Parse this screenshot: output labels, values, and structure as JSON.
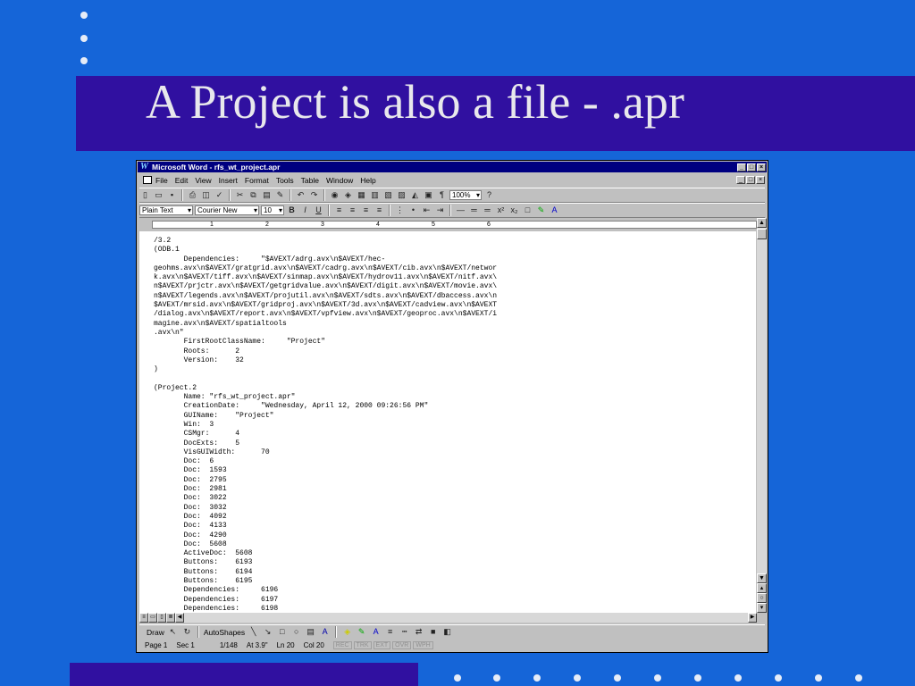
{
  "slide": {
    "title": "A Project is also a file - .apr"
  },
  "window": {
    "title": "Microsoft Word - rfs_wt_project.apr",
    "menu": [
      "File",
      "Edit",
      "View",
      "Insert",
      "Format",
      "Tools",
      "Table",
      "Window",
      "Help"
    ]
  },
  "formatting": {
    "style": "Plain Text",
    "font": "Courier New",
    "size": "10",
    "zoom": "100%",
    "bold": "B",
    "italic": "I",
    "underline": "U"
  },
  "ruler": {
    "numbers": [
      "1",
      "2",
      "3",
      "4",
      "5",
      "6"
    ]
  },
  "document": {
    "text": "/3.2\n(ODB.1\n       Dependencies:     \"$AVEXT/adrg.avx\\n$AVEXT/hec-\ngeohms.avx\\n$AVEXT/gratgrid.avx\\n$AVEXT/cadrg.avx\\n$AVEXT/cib.avx\\n$AVEXT/networ\nk.avx\\n$AVEXT/tiff.avx\\n$AVEXT/sinmap.avx\\n$AVEXT/hydrov11.avx\\n$AVEXT/nitf.avx\\\nn$AVEXT/prjctr.avx\\n$AVEXT/getgridvalue.avx\\n$AVEXT/digit.avx\\n$AVEXT/movie.avx\\\nn$AVEXT/legends.avx\\n$AVEXT/projutil.avx\\n$AVEXT/sdts.avx\\n$AVEXT/dbaccess.avx\\n\n$AVEXT/mrsid.avx\\n$AVEXT/gridproj.avx\\n$AVEXT/3d.avx\\n$AVEXT/cadview.avx\\n$AVEXT\n/dialog.avx\\n$AVEXT/report.avx\\n$AVEXT/vpfview.avx\\n$AVEXT/geoproc.avx\\n$AVEXT/i\nmagine.avx\\n$AVEXT/spatialtools\n.avx\\n\"\n       FirstRootClassName:     \"Project\"\n       Roots:      2\n       Version:    32\n)\n\n(Project.2\n       Name: \"rfs_wt_project.apr\"\n       CreationDate:     \"Wednesday, April 12, 2000 09:26:56 PM\"\n       GUIName:    \"Project\"\n       Win:  3\n       CSMgr:      4\n       DocExts:    5\n       VisGUIWidth:      70\n       Doc:  6\n       Doc:  1593\n       Doc:  2795\n       Doc:  2981\n       Doc:  3022\n       Doc:  3032\n       Doc:  4092\n       Doc:  4133\n       Doc:  4290\n       Doc:  5608\n       ActiveDoc:  5608\n       Buttons:    6193\n       Buttons:    6194\n       Buttons:    6195\n       Dependencies:     6196\n       Dependencies:     6197\n       Dependencies:     6198"
  },
  "drawbar": {
    "draw": "Draw",
    "autoshapes": "AutoShapes"
  },
  "status": {
    "page": "Page 1",
    "sec": "Sec 1",
    "pages": "1/148",
    "at": "At 3.9\"",
    "ln": "Ln 20",
    "col": "Col 20",
    "modes": [
      "REC",
      "TRK",
      "EXT",
      "OVR",
      "WPH"
    ]
  }
}
